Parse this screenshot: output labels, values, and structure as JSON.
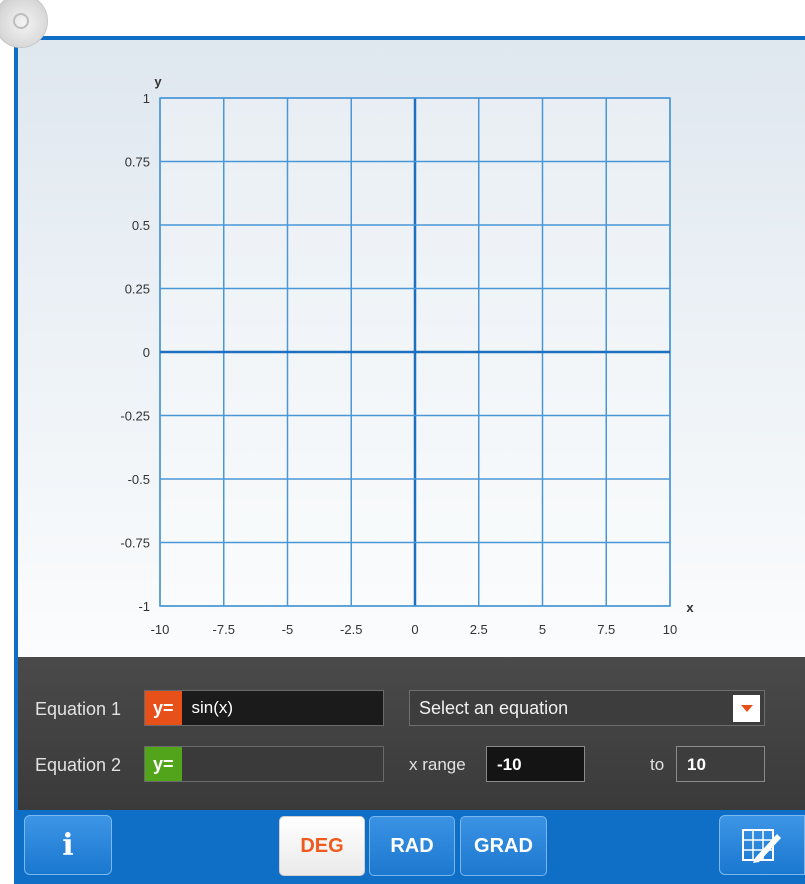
{
  "graph": {
    "x_axis_label": "x",
    "y_axis_label": "y",
    "x_ticks": [
      "-10",
      "-7.5",
      "-5",
      "-2.5",
      "0",
      "2.5",
      "5",
      "7.5",
      "10"
    ],
    "y_ticks": [
      "1",
      "0.75",
      "0.5",
      "0.25",
      "0",
      "-0.25",
      "-0.5",
      "-0.75",
      "-1"
    ],
    "x_range": [
      -10,
      10
    ],
    "y_range": [
      -1,
      1
    ],
    "grid_color": "#4a97d7",
    "axis_color": "#1d6fc0"
  },
  "equations": {
    "eq1": {
      "label": "Equation 1",
      "prefix": "y=",
      "value": "sin(x)",
      "prefix_color": "#e8501a"
    },
    "eq2": {
      "label": "Equation 2",
      "prefix": "y=",
      "value": "",
      "prefix_color": "#52a51a"
    }
  },
  "select": {
    "value": "Select an equation"
  },
  "range": {
    "label": "x range",
    "from": "-10",
    "to_label": "to",
    "to": "10"
  },
  "toolbar": {
    "info_label": "i",
    "modes": [
      "DEG",
      "RAD",
      "GRAD"
    ],
    "active_mode": "DEG",
    "settings_icon": "graph-settings-icon"
  },
  "colors": {
    "frame": "#0f6fc6",
    "panel": "#444444",
    "accent": "#f05a1e"
  }
}
